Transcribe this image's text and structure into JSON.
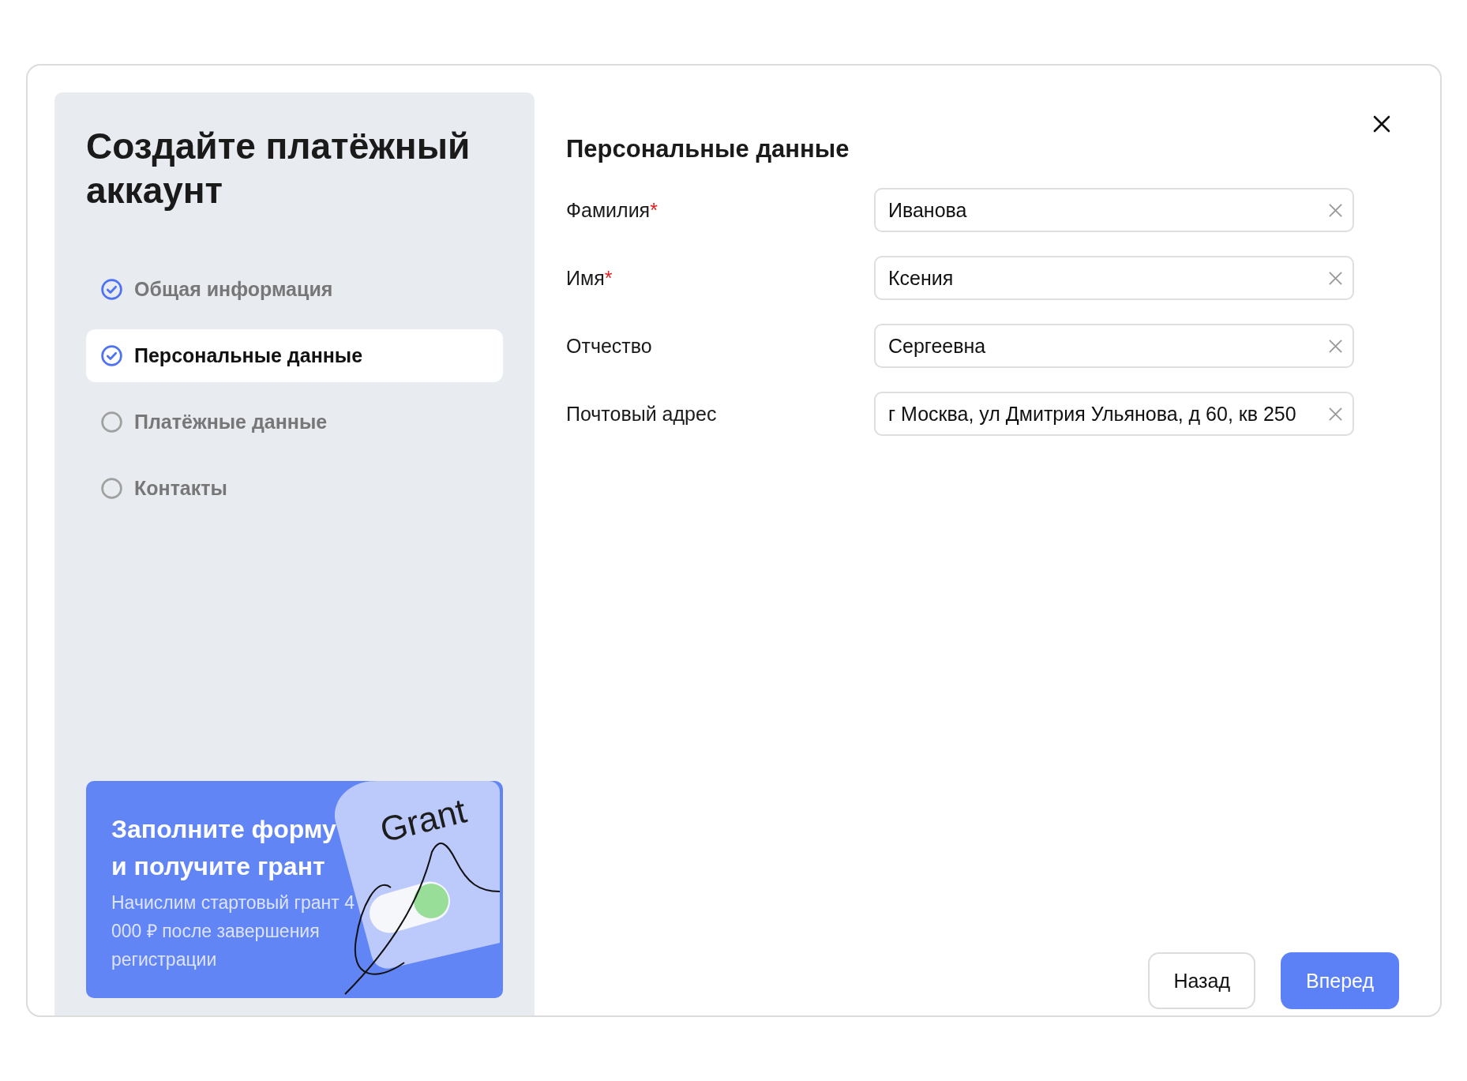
{
  "sidebar": {
    "title": "Создайте платёжный аккаунт",
    "steps": [
      {
        "label": "Общая информация",
        "done": true,
        "selected": false
      },
      {
        "label": "Персональные данные",
        "done": true,
        "selected": true
      },
      {
        "label": "Платёжные данные",
        "done": false,
        "selected": false
      },
      {
        "label": "Контакты",
        "done": false,
        "selected": false
      }
    ],
    "promo": {
      "title": "Заполните форму и получите грант",
      "text": "Начислим стартовый грант 4 000 ₽ после завершения регистрации",
      "card_label": "Grant"
    }
  },
  "form": {
    "title": "Персональные данные",
    "fields": [
      {
        "label": "Фамилия",
        "required_mark": "*",
        "value": "Иванова"
      },
      {
        "label": "Имя",
        "required_mark": "*",
        "value": "Ксения"
      },
      {
        "label": "Отчество",
        "value": "Сергеевна"
      },
      {
        "label": "Почтовый адрес",
        "value": "г Москва, ул Дмитрия Ульянова, д 60, кв 250"
      }
    ],
    "buttons": [
      {
        "label": "Назад",
        "kind": "secondary"
      },
      {
        "label": "Вперед",
        "kind": "primary"
      }
    ]
  }
}
